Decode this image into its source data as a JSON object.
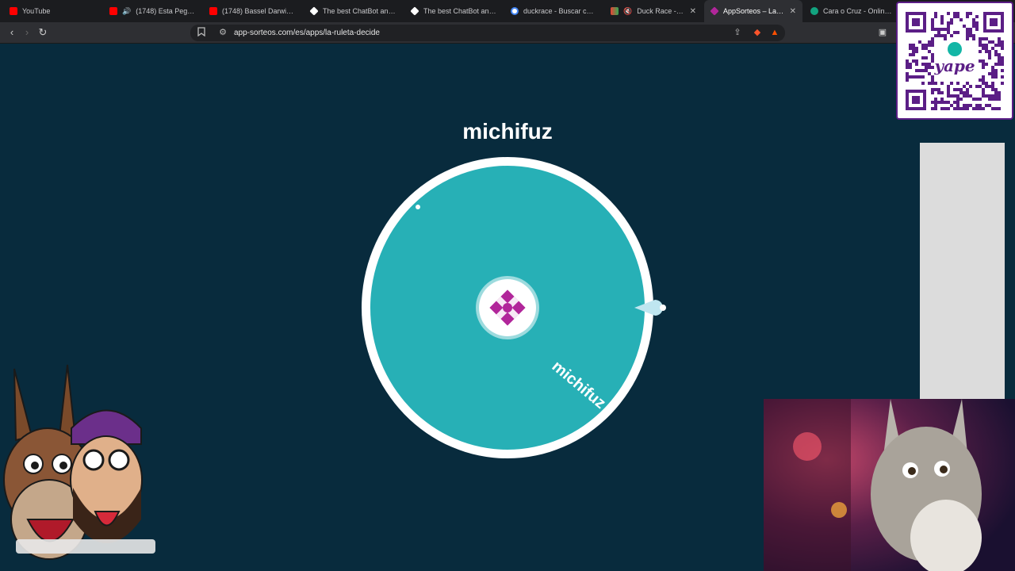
{
  "browser": {
    "tabs": [
      {
        "label": "YouTube",
        "favicon_color": "#ff0000"
      },
      {
        "label": "(1748) Esta Pegao (Re",
        "favicon_color": "#ff0000"
      },
      {
        "label": "(1748) Bassel Darwish - Cr",
        "favicon_color": "#ff0000"
      },
      {
        "label": "The best ChatBot and Wi",
        "favicon_color": "#ffffff"
      },
      {
        "label": "The best ChatBot and Wi",
        "favicon_color": "#ffffff"
      },
      {
        "label": "duckrace - Buscar con Go",
        "favicon_color": "#4285f4"
      },
      {
        "label": "Duck Race - Duck",
        "favicon_color": "#34a853"
      },
      {
        "label": "AppSorteos – La Rul",
        "favicon_color": "#b1269a"
      },
      {
        "label": "Cara o Cruz - Online Tirar",
        "favicon_color": "#12a37f"
      }
    ],
    "url": "app-sorteos.com/es/apps/la-ruleta-decide"
  },
  "wheel": {
    "title": "michifuz",
    "segments": [
      {
        "label": "michifuz",
        "color": "#27b0b6"
      }
    ],
    "ring_color": "#ffffff"
  },
  "overlay": {
    "qr_brand": "yape",
    "qr_color": "#5b1e86"
  }
}
